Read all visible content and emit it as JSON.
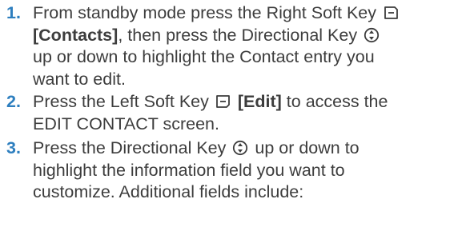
{
  "steps": [
    {
      "number": "1.",
      "lines": [
        [
          "From standby mode press the Right Soft Key"
        ],
        [
          "[Contacts]",
          ", then press the Directional Key"
        ],
        [
          "up or down to highlight the Contact entry you"
        ],
        [
          "want to edit."
        ]
      ]
    },
    {
      "number": "2.",
      "lines": [
        [
          "Press the Left Soft Key",
          "[Edit]",
          " to access the"
        ],
        [
          "EDIT CONTACT screen."
        ]
      ]
    },
    {
      "number": "3.",
      "lines": [
        [
          "Press the Directional Key",
          "up or down to"
        ],
        [
          "highlight the information field you want to"
        ],
        [
          "customize. Additional fields include:"
        ]
      ]
    }
  ],
  "icons": [
    "right-soft-key-icon",
    "directional-key-icon",
    "left-soft-key-icon"
  ]
}
